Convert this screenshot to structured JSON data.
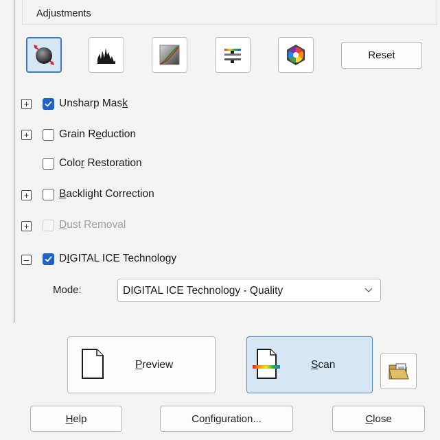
{
  "header": {
    "title": "Adjustments"
  },
  "toolbar": {
    "tools": [
      {
        "name": "auto-exposure",
        "active": true
      },
      {
        "name": "histogram-adjustment",
        "active": false
      },
      {
        "name": "tone-correction",
        "active": false
      },
      {
        "name": "image-adjustment",
        "active": false
      },
      {
        "name": "color-palette",
        "active": false
      }
    ],
    "reset_label": "Reset"
  },
  "options": {
    "unsharp_mask": {
      "pre": "Unsharp Mas",
      "key": "k",
      "post": "",
      "checked": true,
      "expander": "+"
    },
    "grain_reduction": {
      "pre": "Grain R",
      "key": "e",
      "post": "duction",
      "checked": false,
      "expander": "+"
    },
    "color_restoration": {
      "pre": "Colo",
      "key": "r",
      "post": " Restoration",
      "checked": false
    },
    "backlight_correction": {
      "pre": "",
      "key": "B",
      "post": "acklight Correction",
      "checked": false,
      "expander": "+"
    },
    "dust_removal": {
      "pre": "",
      "key": "D",
      "post": "ust Removal",
      "checked": false,
      "disabled": true,
      "expander": "+"
    },
    "digital_ice": {
      "pre": "D",
      "key": "I",
      "post": "GITAL ICE Technology",
      "checked": true,
      "expander": "–"
    }
  },
  "mode": {
    "label": "Mode:",
    "selected": "DIGITAL ICE Technology - Quality"
  },
  "actions": {
    "preview": {
      "key": "P",
      "rest": "review"
    },
    "scan": {
      "key": "S",
      "rest": "can"
    },
    "help": {
      "key": "H",
      "rest": "elp"
    },
    "configuration": {
      "pre": "Co",
      "key": "n",
      "post": "figuration..."
    },
    "close": {
      "key": "C",
      "rest": "lose"
    }
  },
  "colors": {
    "accent": "#1f63c8",
    "scan_bg": "#d6e8f6"
  }
}
